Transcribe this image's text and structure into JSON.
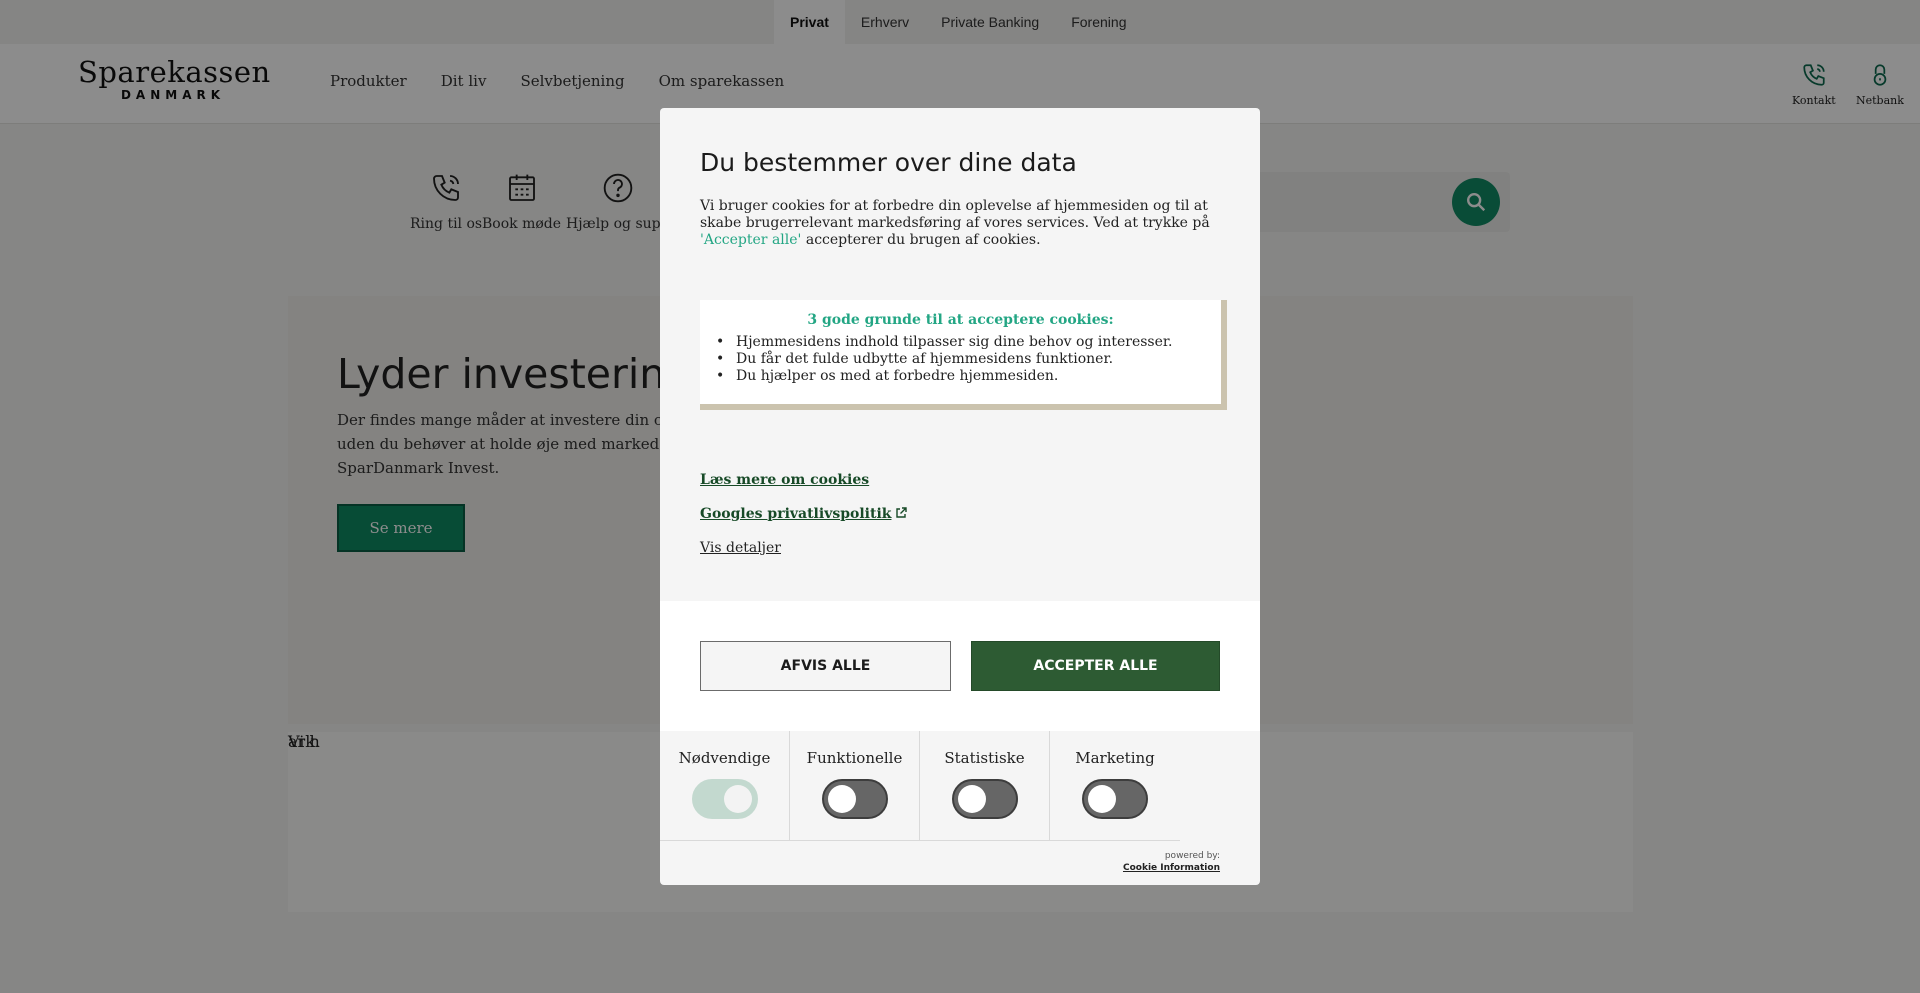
{
  "topbar": {
    "segments": [
      "Privat",
      "Erhverv",
      "Private Banking",
      "Forening"
    ],
    "active": "Privat"
  },
  "header": {
    "logo_main": "Sparekassen",
    "logo_sub": "DANMARK",
    "nav": [
      "Produkter",
      "Dit liv",
      "Selvbetjening",
      "Om sparekassen"
    ],
    "utility": [
      {
        "label": "Kontakt",
        "icon": "phone-icon"
      },
      {
        "label": "Netbank",
        "icon": "lock-icon"
      }
    ]
  },
  "quicklinks": [
    {
      "label": "Ring til os",
      "icon": "phone-icon"
    },
    {
      "label": "Book møde",
      "icon": "calendar-icon"
    },
    {
      "label": "Hjælp og supp",
      "icon": "help-icon"
    }
  ],
  "hero": {
    "heading": "Lyder investering s",
    "body": "Der findes mange måder at investere din ops uden du behøver at holde øje med markede SparDanmark Invest.",
    "cta": "Se mere"
  },
  "lower": {
    "left_text": "Vi h",
    "right_text": "ark."
  },
  "modal": {
    "title": "Du bestemmer over dine data",
    "intro_before": "Vi bruger cookies for at forbedre din oplevelse af hjemmesiden og til at skabe brugerrelevant markedsføring af vores services. Ved at trykke på ",
    "intro_highlight": "'Accepter alle'",
    "intro_after": " accepterer du brugen af cookies.",
    "reasons_title": "3 gode grunde til at acceptere cookies:",
    "reasons": [
      "Hjemmesidens indhold tilpasser sig dine behov og interesser.",
      "Du får det fulde udbytte af hjemmesidens funktioner.",
      "Du hjælper os med at forbedre hjemmesiden."
    ],
    "link_cookies": "Læs mere om cookies",
    "link_google": "Googles privatlivspolitik",
    "link_details": "Vis detaljer",
    "reject_label": "AFVIS ALLE",
    "accept_label": "ACCEPTER ALLE",
    "categories": [
      {
        "label": "Nødvendige",
        "enabled": true
      },
      {
        "label": "Funktionelle",
        "enabled": false
      },
      {
        "label": "Statistiske",
        "enabled": false
      },
      {
        "label": "Marketing",
        "enabled": false
      }
    ],
    "powered_by": "powered by:",
    "powered_name": "Cookie Information"
  },
  "colors": {
    "brand_green": "#0d8a63",
    "accept_green": "#2d5b33",
    "highlight_teal": "#23a684"
  }
}
